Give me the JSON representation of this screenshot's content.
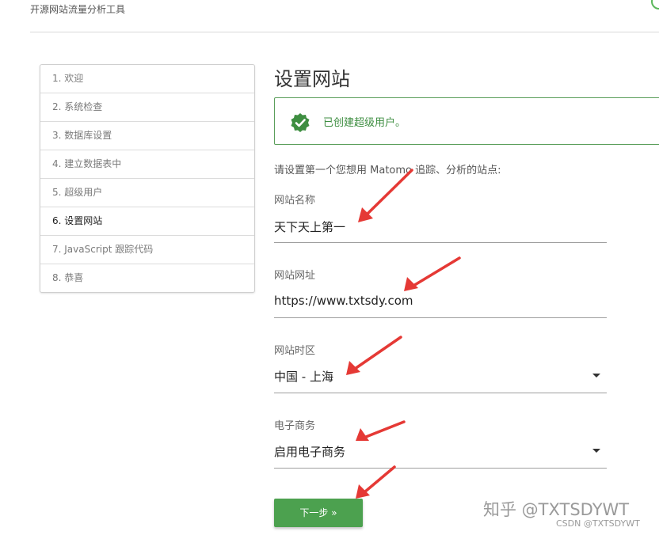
{
  "header": {
    "subtitle": "开源网站流量分析工具"
  },
  "steps": [
    {
      "label": "1. 欢迎",
      "active": false
    },
    {
      "label": "2. 系统检查",
      "active": false
    },
    {
      "label": "3. 数据库设置",
      "active": false
    },
    {
      "label": "4. 建立数据表中",
      "active": false
    },
    {
      "label": "5. 超级用户",
      "active": false
    },
    {
      "label": "6. 设置网站",
      "active": true
    },
    {
      "label": "7. JavaScript 跟踪代码",
      "active": false
    },
    {
      "label": "8. 恭喜",
      "active": false
    }
  ],
  "main": {
    "title": "设置网站",
    "alert": {
      "text": "已创建超级用户。",
      "icon": "check-badge-icon",
      "color": "#3e8e41"
    },
    "intro": "请设置第一个您想用 Matomo 追踪、分析的站点:",
    "fields": {
      "site_name": {
        "label": "网站名称",
        "value": "天下天上第一"
      },
      "site_url": {
        "label": "网站网址",
        "value": "https://www.txtsdy.com"
      },
      "timezone": {
        "label": "网站时区",
        "value": "中国 - 上海"
      },
      "ecommerce": {
        "label": "电子商务",
        "value": "启用电子商务"
      }
    },
    "next_button": "下一步 »"
  },
  "annotations": {
    "arrow_color": "#e53935"
  },
  "watermarks": {
    "zhihu": "知乎 @TXTSDYWT",
    "csdn": "CSDN @TXTSDYWT"
  },
  "colors": {
    "accent_green": "#4ca14f",
    "border_gray": "#cfcfcf"
  }
}
